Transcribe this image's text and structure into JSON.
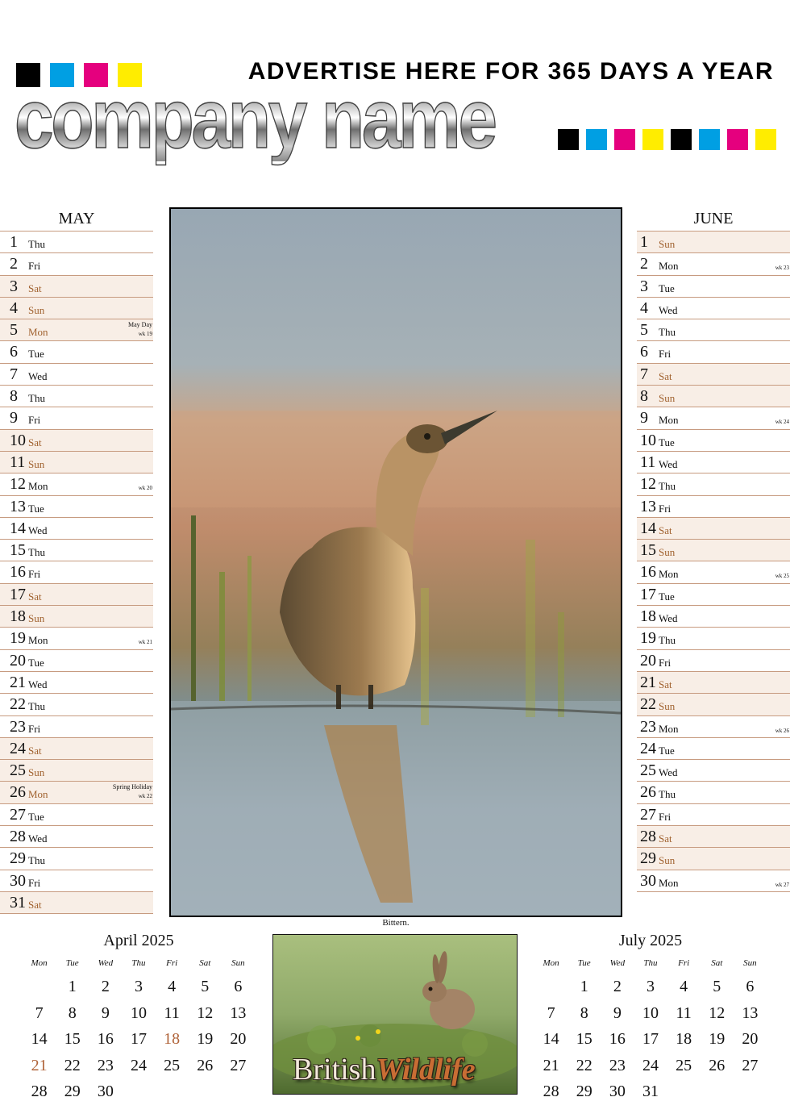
{
  "header": {
    "advert": "ADVERTISE HERE FOR 365 DAYS A YEAR",
    "company": "company name",
    "cmyk_colors": [
      "#000000",
      "#009fe3",
      "#e5007e",
      "#ffed00"
    ]
  },
  "may": {
    "title": "MAY",
    "days": [
      {
        "n": "1",
        "d": "Thu"
      },
      {
        "n": "2",
        "d": "Fri"
      },
      {
        "n": "3",
        "d": "Sat",
        "we": true
      },
      {
        "n": "4",
        "d": "Sun",
        "we": true
      },
      {
        "n": "5",
        "d": "Mon",
        "we": true,
        "hol": "May Day",
        "wk": "wk 19"
      },
      {
        "n": "6",
        "d": "Tue"
      },
      {
        "n": "7",
        "d": "Wed"
      },
      {
        "n": "8",
        "d": "Thu"
      },
      {
        "n": "9",
        "d": "Fri"
      },
      {
        "n": "10",
        "d": "Sat",
        "we": true
      },
      {
        "n": "11",
        "d": "Sun",
        "we": true
      },
      {
        "n": "12",
        "d": "Mon",
        "wk": "wk 20"
      },
      {
        "n": "13",
        "d": "Tue"
      },
      {
        "n": "14",
        "d": "Wed"
      },
      {
        "n": "15",
        "d": "Thu"
      },
      {
        "n": "16",
        "d": "Fri"
      },
      {
        "n": "17",
        "d": "Sat",
        "we": true
      },
      {
        "n": "18",
        "d": "Sun",
        "we": true
      },
      {
        "n": "19",
        "d": "Mon",
        "wk": "wk 21"
      },
      {
        "n": "20",
        "d": "Tue"
      },
      {
        "n": "21",
        "d": "Wed"
      },
      {
        "n": "22",
        "d": "Thu"
      },
      {
        "n": "23",
        "d": "Fri"
      },
      {
        "n": "24",
        "d": "Sat",
        "we": true
      },
      {
        "n": "25",
        "d": "Sun",
        "we": true
      },
      {
        "n": "26",
        "d": "Mon",
        "we": true,
        "hol": "Spring Holiday",
        "wk": "wk 22"
      },
      {
        "n": "27",
        "d": "Tue"
      },
      {
        "n": "28",
        "d": "Wed"
      },
      {
        "n": "29",
        "d": "Thu"
      },
      {
        "n": "30",
        "d": "Fri"
      },
      {
        "n": "31",
        "d": "Sat",
        "we": true
      }
    ]
  },
  "june": {
    "title": "JUNE",
    "days": [
      {
        "n": "1",
        "d": "Sun",
        "we": true
      },
      {
        "n": "2",
        "d": "Mon",
        "wk": "wk 23"
      },
      {
        "n": "3",
        "d": "Tue"
      },
      {
        "n": "4",
        "d": "Wed"
      },
      {
        "n": "5",
        "d": "Thu"
      },
      {
        "n": "6",
        "d": "Fri"
      },
      {
        "n": "7",
        "d": "Sat",
        "we": true
      },
      {
        "n": "8",
        "d": "Sun",
        "we": true
      },
      {
        "n": "9",
        "d": "Mon",
        "wk": "wk 24"
      },
      {
        "n": "10",
        "d": "Tue"
      },
      {
        "n": "11",
        "d": "Wed"
      },
      {
        "n": "12",
        "d": "Thu"
      },
      {
        "n": "13",
        "d": "Fri"
      },
      {
        "n": "14",
        "d": "Sat",
        "we": true
      },
      {
        "n": "15",
        "d": "Sun",
        "we": true
      },
      {
        "n": "16",
        "d": "Mon",
        "wk": "wk 25"
      },
      {
        "n": "17",
        "d": "Tue"
      },
      {
        "n": "18",
        "d": "Wed"
      },
      {
        "n": "19",
        "d": "Thu"
      },
      {
        "n": "20",
        "d": "Fri"
      },
      {
        "n": "21",
        "d": "Sat",
        "we": true
      },
      {
        "n": "22",
        "d": "Sun",
        "we": true
      },
      {
        "n": "23",
        "d": "Mon",
        "wk": "wk 26"
      },
      {
        "n": "24",
        "d": "Tue"
      },
      {
        "n": "25",
        "d": "Wed"
      },
      {
        "n": "26",
        "d": "Thu"
      },
      {
        "n": "27",
        "d": "Fri"
      },
      {
        "n": "28",
        "d": "Sat",
        "we": true
      },
      {
        "n": "29",
        "d": "Sun",
        "we": true
      },
      {
        "n": "30",
        "d": "Mon",
        "wk": "wk 27"
      }
    ]
  },
  "photo": {
    "caption": "Bittern."
  },
  "april": {
    "title": "April 2025",
    "headers": [
      "Mon",
      "Tue",
      "Wed",
      "Thu",
      "Fri",
      "Sat",
      "Sun"
    ],
    "weeks": [
      [
        "",
        "1",
        "2",
        "3",
        "4",
        "5",
        "6"
      ],
      [
        "7",
        "8",
        "9",
        "10",
        "11",
        "12",
        "13"
      ],
      [
        "14",
        "15",
        "16",
        "17",
        "18",
        "19",
        "20"
      ],
      [
        "21",
        "22",
        "23",
        "24",
        "25",
        "26",
        "27"
      ],
      [
        "28",
        "29",
        "30",
        "",
        "",
        "",
        ""
      ]
    ],
    "highlighted": [
      "18",
      "21"
    ]
  },
  "july": {
    "title": "July 2025",
    "headers": [
      "Mon",
      "Tue",
      "Wed",
      "Thu",
      "Fri",
      "Sat",
      "Sun"
    ],
    "weeks": [
      [
        "",
        "1",
        "2",
        "3",
        "4",
        "5",
        "6"
      ],
      [
        "7",
        "8",
        "9",
        "10",
        "11",
        "12",
        "13"
      ],
      [
        "14",
        "15",
        "16",
        "17",
        "18",
        "19",
        "20"
      ],
      [
        "21",
        "22",
        "23",
        "24",
        "25",
        "26",
        "27"
      ],
      [
        "28",
        "29",
        "30",
        "31",
        "",
        "",
        ""
      ]
    ],
    "highlighted": []
  },
  "brand": {
    "word1": "British",
    "word2": "Wildlife"
  }
}
